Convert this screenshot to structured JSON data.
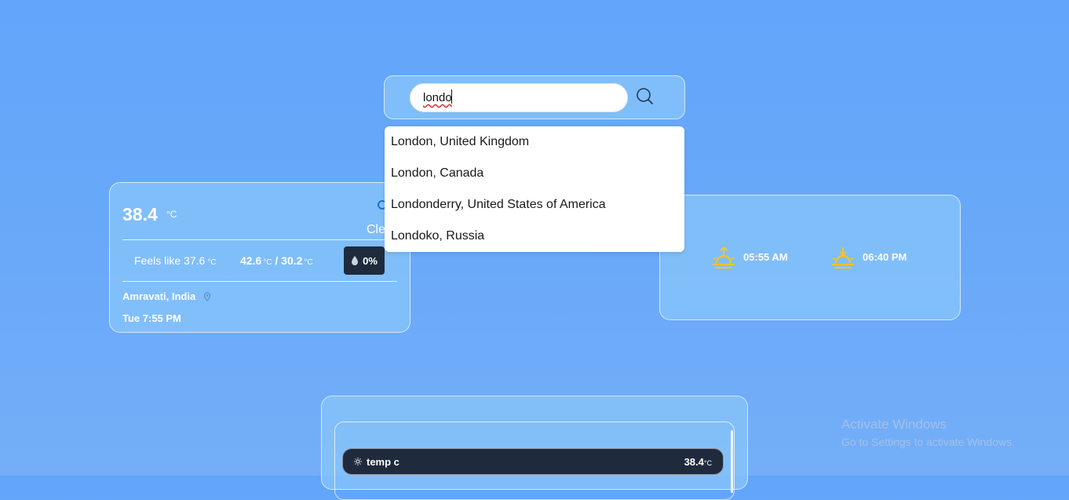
{
  "search": {
    "value": "londo",
    "suggestions": [
      "London, United Kingdom",
      "London, Canada",
      "Londonderry, United States of America",
      "Londoko, Russia"
    ]
  },
  "current": {
    "temperature": "38.4",
    "unit": "°C",
    "condition_partial": "Cle",
    "feels_like_label": "Feels like",
    "feels_like_value": "37.6",
    "high": "42.6",
    "low": "30.2",
    "hilo_separator": "/",
    "precip_chance": "0%",
    "location": "Amravati, India",
    "datetime": "Tue 7:55 PM"
  },
  "sun": {
    "sunrise": "05:55 AM",
    "sunset": "06:40 PM"
  },
  "hourly": {
    "row_label": "temp c",
    "row_value": "38.4"
  },
  "watermark": {
    "title": "Activate Windows",
    "subtitle": "Go to Settings to activate Windows."
  },
  "colors": {
    "background": "#62a5fa",
    "card": "#88c6fa",
    "dark_badge": "#1f2a3d",
    "sun_icon": "#f9c51a"
  }
}
